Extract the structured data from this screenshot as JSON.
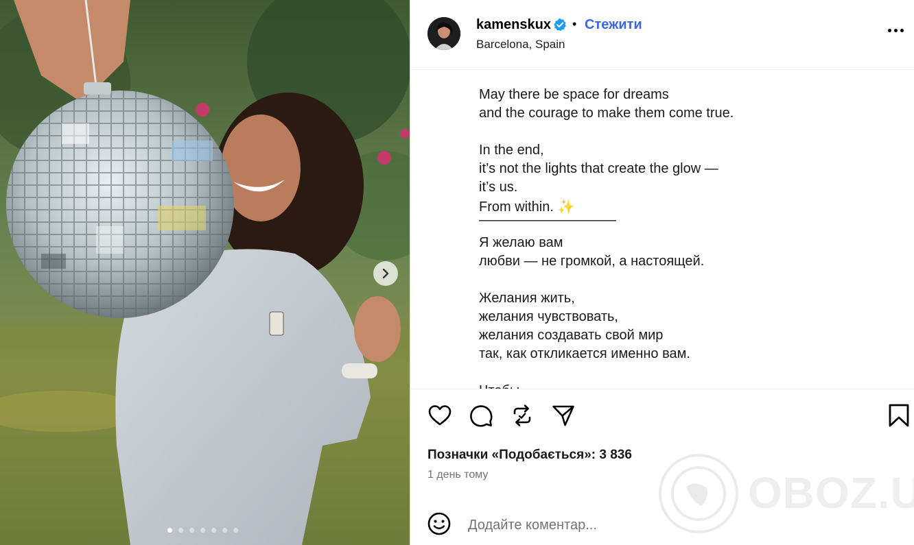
{
  "post": {
    "username": "kamenskux",
    "separator": "•",
    "follow_label": "Стежити",
    "location": "Barcelona, Spain",
    "more_icon": "more-horizontal-icon",
    "verified_icon": "verified-badge-icon"
  },
  "caption": {
    "lines": [
      "May there be space for dreams",
      "and the courage to make them come true.",
      "",
      "In the end,",
      "it’s not the lights that create the glow —",
      "it’s us.",
      "From within. ✨",
      "——————————",
      "Я желаю вам",
      "любви — не громкой, а настоящей.",
      "",
      "Желания жить,",
      "желания чувствовать,",
      "желания создавать свой мир",
      "так, как откликается именно вам.",
      "",
      "Чтобы"
    ]
  },
  "stats": {
    "likes_text": "Позначки «Подобається»: 3 836",
    "time_text": "1 день тому"
  },
  "comment": {
    "placeholder": "Додайте коментар..."
  },
  "carousel": {
    "total": 7,
    "active_index": 0
  },
  "watermark": {
    "text": "OBOZ.UA"
  },
  "colors": {
    "follow": "#3a66e8",
    "verified": "#1d9bf0",
    "muted_text": "#737373",
    "border": "#dbdbdb"
  }
}
